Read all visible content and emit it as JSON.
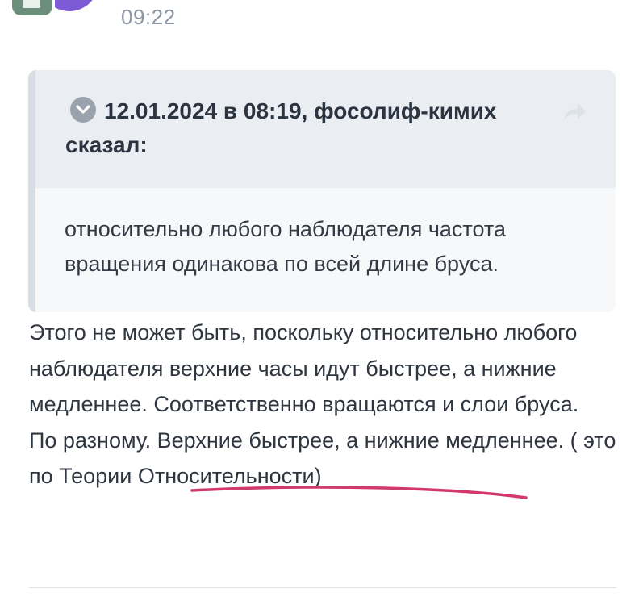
{
  "post": {
    "time": "09:22"
  },
  "quote": {
    "meta": "12.01.2024 в 08:19, фосолиф-кимих сказал:",
    "text": "относительно любого наблюдателя частота вращения одинакова по всей длине бруса."
  },
  "reply": {
    "paragraph1": "Этого не может быть, поскольку относительно любого наблюдателя верхние часы идут быстрее, а нижние медленнее. Соответственно вращаются и слои бруса.",
    "paragraph2": "По разному. Верхние быстрее, а нижние медленнее. ( это по Теории Относительности)"
  },
  "colors": {
    "underline": "#d0386e",
    "avatar": "#7d5bd6"
  }
}
